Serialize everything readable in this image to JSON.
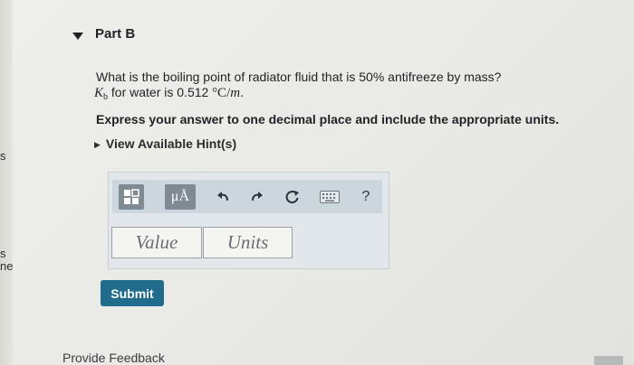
{
  "left_margin": {
    "fragments": [
      "s",
      "s",
      "ne"
    ]
  },
  "part": {
    "title": "Part B"
  },
  "question": {
    "text": "What is the boiling point of radiator fluid that is 50% antifreeze by mass?",
    "kb_symbol": "K",
    "kb_subscript": "b",
    "kb_text": " for water is ",
    "kb_value": "0.512",
    "kb_unit_deg": " °C/",
    "kb_unit_var": "m",
    "kb_end": "."
  },
  "instruction": "Express your answer to one decimal place and include the appropriate units.",
  "hint": {
    "label": "View Available Hint(s)"
  },
  "toolbar": {
    "buttons": [
      {
        "name": "templates-icon"
      },
      {
        "name": "micro-angstrom-icon",
        "label": "μÅ"
      },
      {
        "name": "undo-icon"
      },
      {
        "name": "redo-icon"
      },
      {
        "name": "reset-icon"
      },
      {
        "name": "keyboard-icon"
      },
      {
        "name": "help-icon",
        "label": "?"
      }
    ]
  },
  "answer": {
    "value_placeholder": "Value",
    "units_placeholder": "Units"
  },
  "submit": {
    "label": "Submit"
  },
  "feedback": {
    "label": "Provide Feedback"
  },
  "colors": {
    "submit": "#1f6c8d",
    "toolbar_button": "#7f8a92",
    "panel": "#e1e7ea"
  }
}
